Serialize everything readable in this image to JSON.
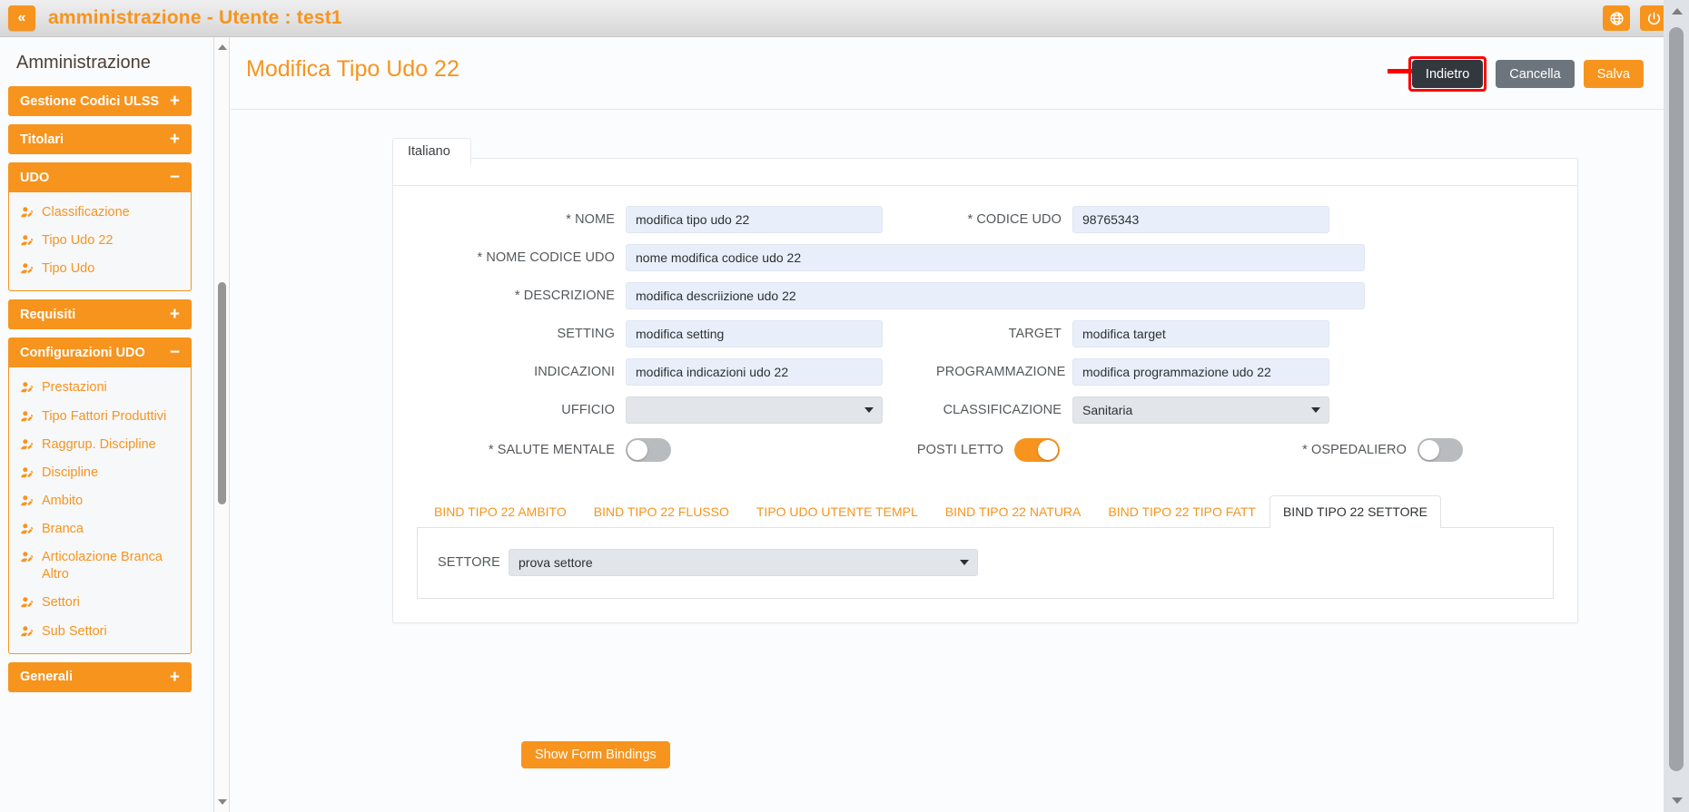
{
  "topbar": {
    "collapse_label": "«",
    "title": "amministrazione - Utente : test1",
    "icons": [
      {
        "name": "globe-icon",
        "label": "globe"
      },
      {
        "name": "power-icon",
        "label": "power"
      }
    ]
  },
  "sidebar": {
    "title": "Amministrazione",
    "groups": [
      {
        "label": "Gestione Codici ULSS",
        "sign": "+",
        "open": false,
        "items": []
      },
      {
        "label": "Titolari",
        "sign": "+",
        "open": false,
        "items": []
      },
      {
        "label": "UDO",
        "sign": "−",
        "open": true,
        "items": [
          "Classificazione",
          "Tipo Udo 22",
          "Tipo Udo"
        ]
      },
      {
        "label": "Requisiti",
        "sign": "+",
        "open": false,
        "items": []
      },
      {
        "label": "Configurazioni UDO",
        "sign": "−",
        "open": true,
        "items": [
          "Prestazioni",
          "Tipo Fattori Produttivi",
          "Raggrup. Discipline",
          "Discipline",
          "Ambito",
          "Branca",
          "Articolazione Branca Altro",
          "Settori",
          "Sub Settori"
        ]
      },
      {
        "label": "Generali",
        "sign": "+",
        "open": false,
        "items": []
      }
    ]
  },
  "page": {
    "title": "Modifica Tipo Udo 22",
    "buttons": {
      "back": "Indietro",
      "cancel": "Cancella",
      "save": "Salva"
    },
    "highlight_color": "#ff0000"
  },
  "form": {
    "lang_tab": "Italiano",
    "fields": {
      "nome": {
        "label": "* NOME",
        "value": "modifica tipo udo 22"
      },
      "codice_udo": {
        "label": "* CODICE UDO",
        "value": "98765343"
      },
      "nome_codice_udo": {
        "label": "* NOME CODICE UDO",
        "value": "nome modifica codice udo 22"
      },
      "descrizione": {
        "label": "* DESCRIZIONE",
        "value": "modifica descriizione udo 22"
      },
      "setting": {
        "label": "SETTING",
        "value": "modifica setting"
      },
      "target": {
        "label": "TARGET",
        "value": "modifica target"
      },
      "indicazioni": {
        "label": "INDICAZIONI",
        "value": "modifica indicazioni udo 22"
      },
      "programmazione": {
        "label": "PROGRAMMAZIONE",
        "value": "modifica programmazione udo 22"
      },
      "ufficio": {
        "label": "UFFICIO",
        "value": ""
      },
      "classificazione": {
        "label": "CLASSIFICAZIONE",
        "value": "Sanitaria"
      }
    },
    "toggles": [
      {
        "label": "* SALUTE MENTALE",
        "on": false
      },
      {
        "label": "POSTI LETTO",
        "on": true
      },
      {
        "label": "* OSPEDALIERO",
        "on": false
      }
    ]
  },
  "bindings": {
    "tabs": [
      {
        "label": "BIND TIPO 22 AMBITO",
        "active": false
      },
      {
        "label": "BIND TIPO 22 FLUSSO",
        "active": false
      },
      {
        "label": "TIPO UDO UTENTE TEMPL",
        "active": false
      },
      {
        "label": "BIND TIPO 22 NATURA",
        "active": false
      },
      {
        "label": "BIND TIPO 22 TIPO FATT",
        "active": false
      },
      {
        "label": "BIND TIPO 22 SETTORE",
        "active": true
      }
    ],
    "settore": {
      "label": "SETTORE",
      "value": "prova settore"
    }
  },
  "footer": {
    "show_bindings": "Show Form Bindings"
  },
  "colors": {
    "accent": "#f7941e",
    "dark_button": "#32383e",
    "grey_button": "#6c757d",
    "input_bg": "#e9effa",
    "select_bg": "#e2e5e9"
  }
}
